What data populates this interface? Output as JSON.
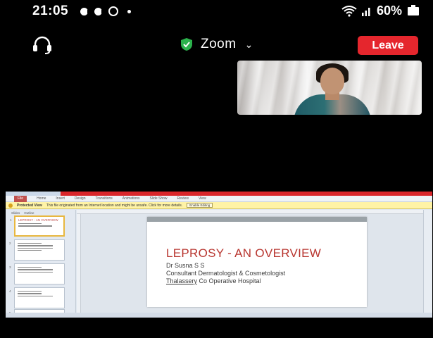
{
  "status_bar": {
    "time": "21:05",
    "battery": "60%"
  },
  "zoom": {
    "title": "Zoom",
    "leave_label": "Leave",
    "accent_leave": "#e5262d",
    "shield_color": "#2bb24c"
  },
  "powerpoint": {
    "ribbon_tabs": [
      "File",
      "Home",
      "Insert",
      "Design",
      "Transitions",
      "Animations",
      "Slide Show",
      "Review",
      "View"
    ],
    "protected_view_label": "Protected View",
    "protected_view_message": "This file originated from an Internet location and might be unsafe. Click for more details.",
    "enable_editing_label": "Enable Editing",
    "pane_tabs": [
      "Slides",
      "Outline"
    ],
    "thumbnails": [
      {
        "number": "1",
        "title": "LEPROSY - AN OVERVIEW"
      },
      {
        "number": "2",
        "title": ""
      },
      {
        "number": "3",
        "title": ""
      },
      {
        "number": "4",
        "title": ""
      },
      {
        "number": "5",
        "title": ""
      }
    ],
    "slide": {
      "title": "LEPROSY - AN OVERVIEW",
      "author": "Dr Susna S S",
      "role": "Consultant Dermatologist & Cosmetologist",
      "hospital_place": "Thalassery",
      "hospital_rest": " Co Operative Hospital"
    }
  }
}
